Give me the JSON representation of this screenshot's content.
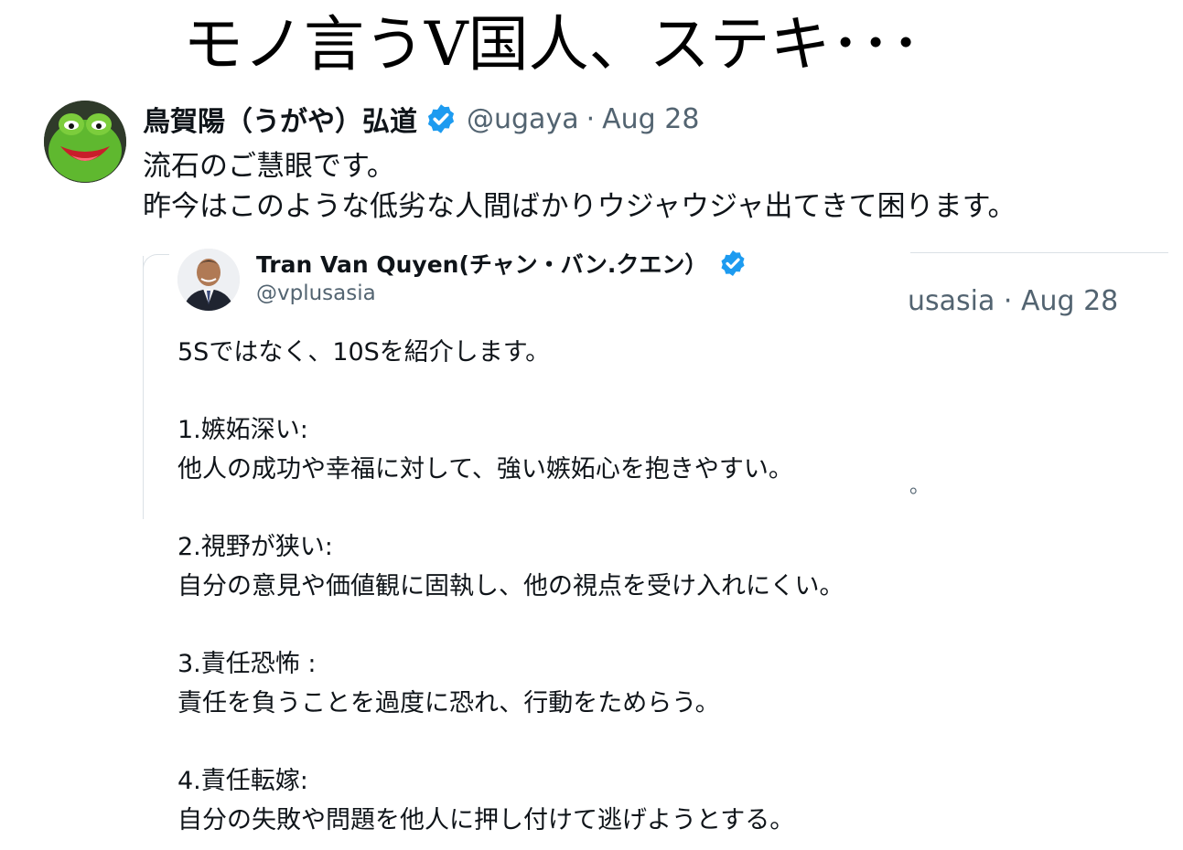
{
  "headline": "モノ言うV国人、ステキ･･･",
  "tweet": {
    "author_name": "鳥賀陽（うがや）弘道",
    "handle": "@ugaya",
    "separator": "·",
    "date": "Aug 28",
    "text_lines": [
      "流石のご慧眼です。",
      "昨今はこのような低劣な人間ばかりウジャウジャ出てきて困ります。"
    ],
    "avatar_icon": "kermit-avatar-icon",
    "verified_icon": "verified-badge-icon"
  },
  "quoted": {
    "author_name": "Tran Van Quyen(チャン・バン.クエン）",
    "handle": "@vplusasia",
    "ghost_meta": "usasia · Aug 28",
    "ghost_dot": "。",
    "avatar_icon": "person-avatar-icon",
    "lines": [
      "5Sではなく、10Sを紹介します。",
      "",
      "1.嫉妬深い:",
      "他人の成功や幸福に対して、強い嫉妬心を抱きやすい。",
      "",
      "2.視野が狭い:",
      "自分の意見や価値観に固執し、他の視点を受け入れにくい。",
      "",
      "3.責任恐怖 :",
      "責任を負うことを過度に恐れ、行動をためらう。",
      "",
      "4.責任転嫁:",
      "自分の失敗や問題を他人に押し付けて逃げようとする。"
    ]
  },
  "colors": {
    "text": "#0f1419",
    "muted": "#536471",
    "verified": "#1d9bf0",
    "border": "#dbe1e6"
  }
}
